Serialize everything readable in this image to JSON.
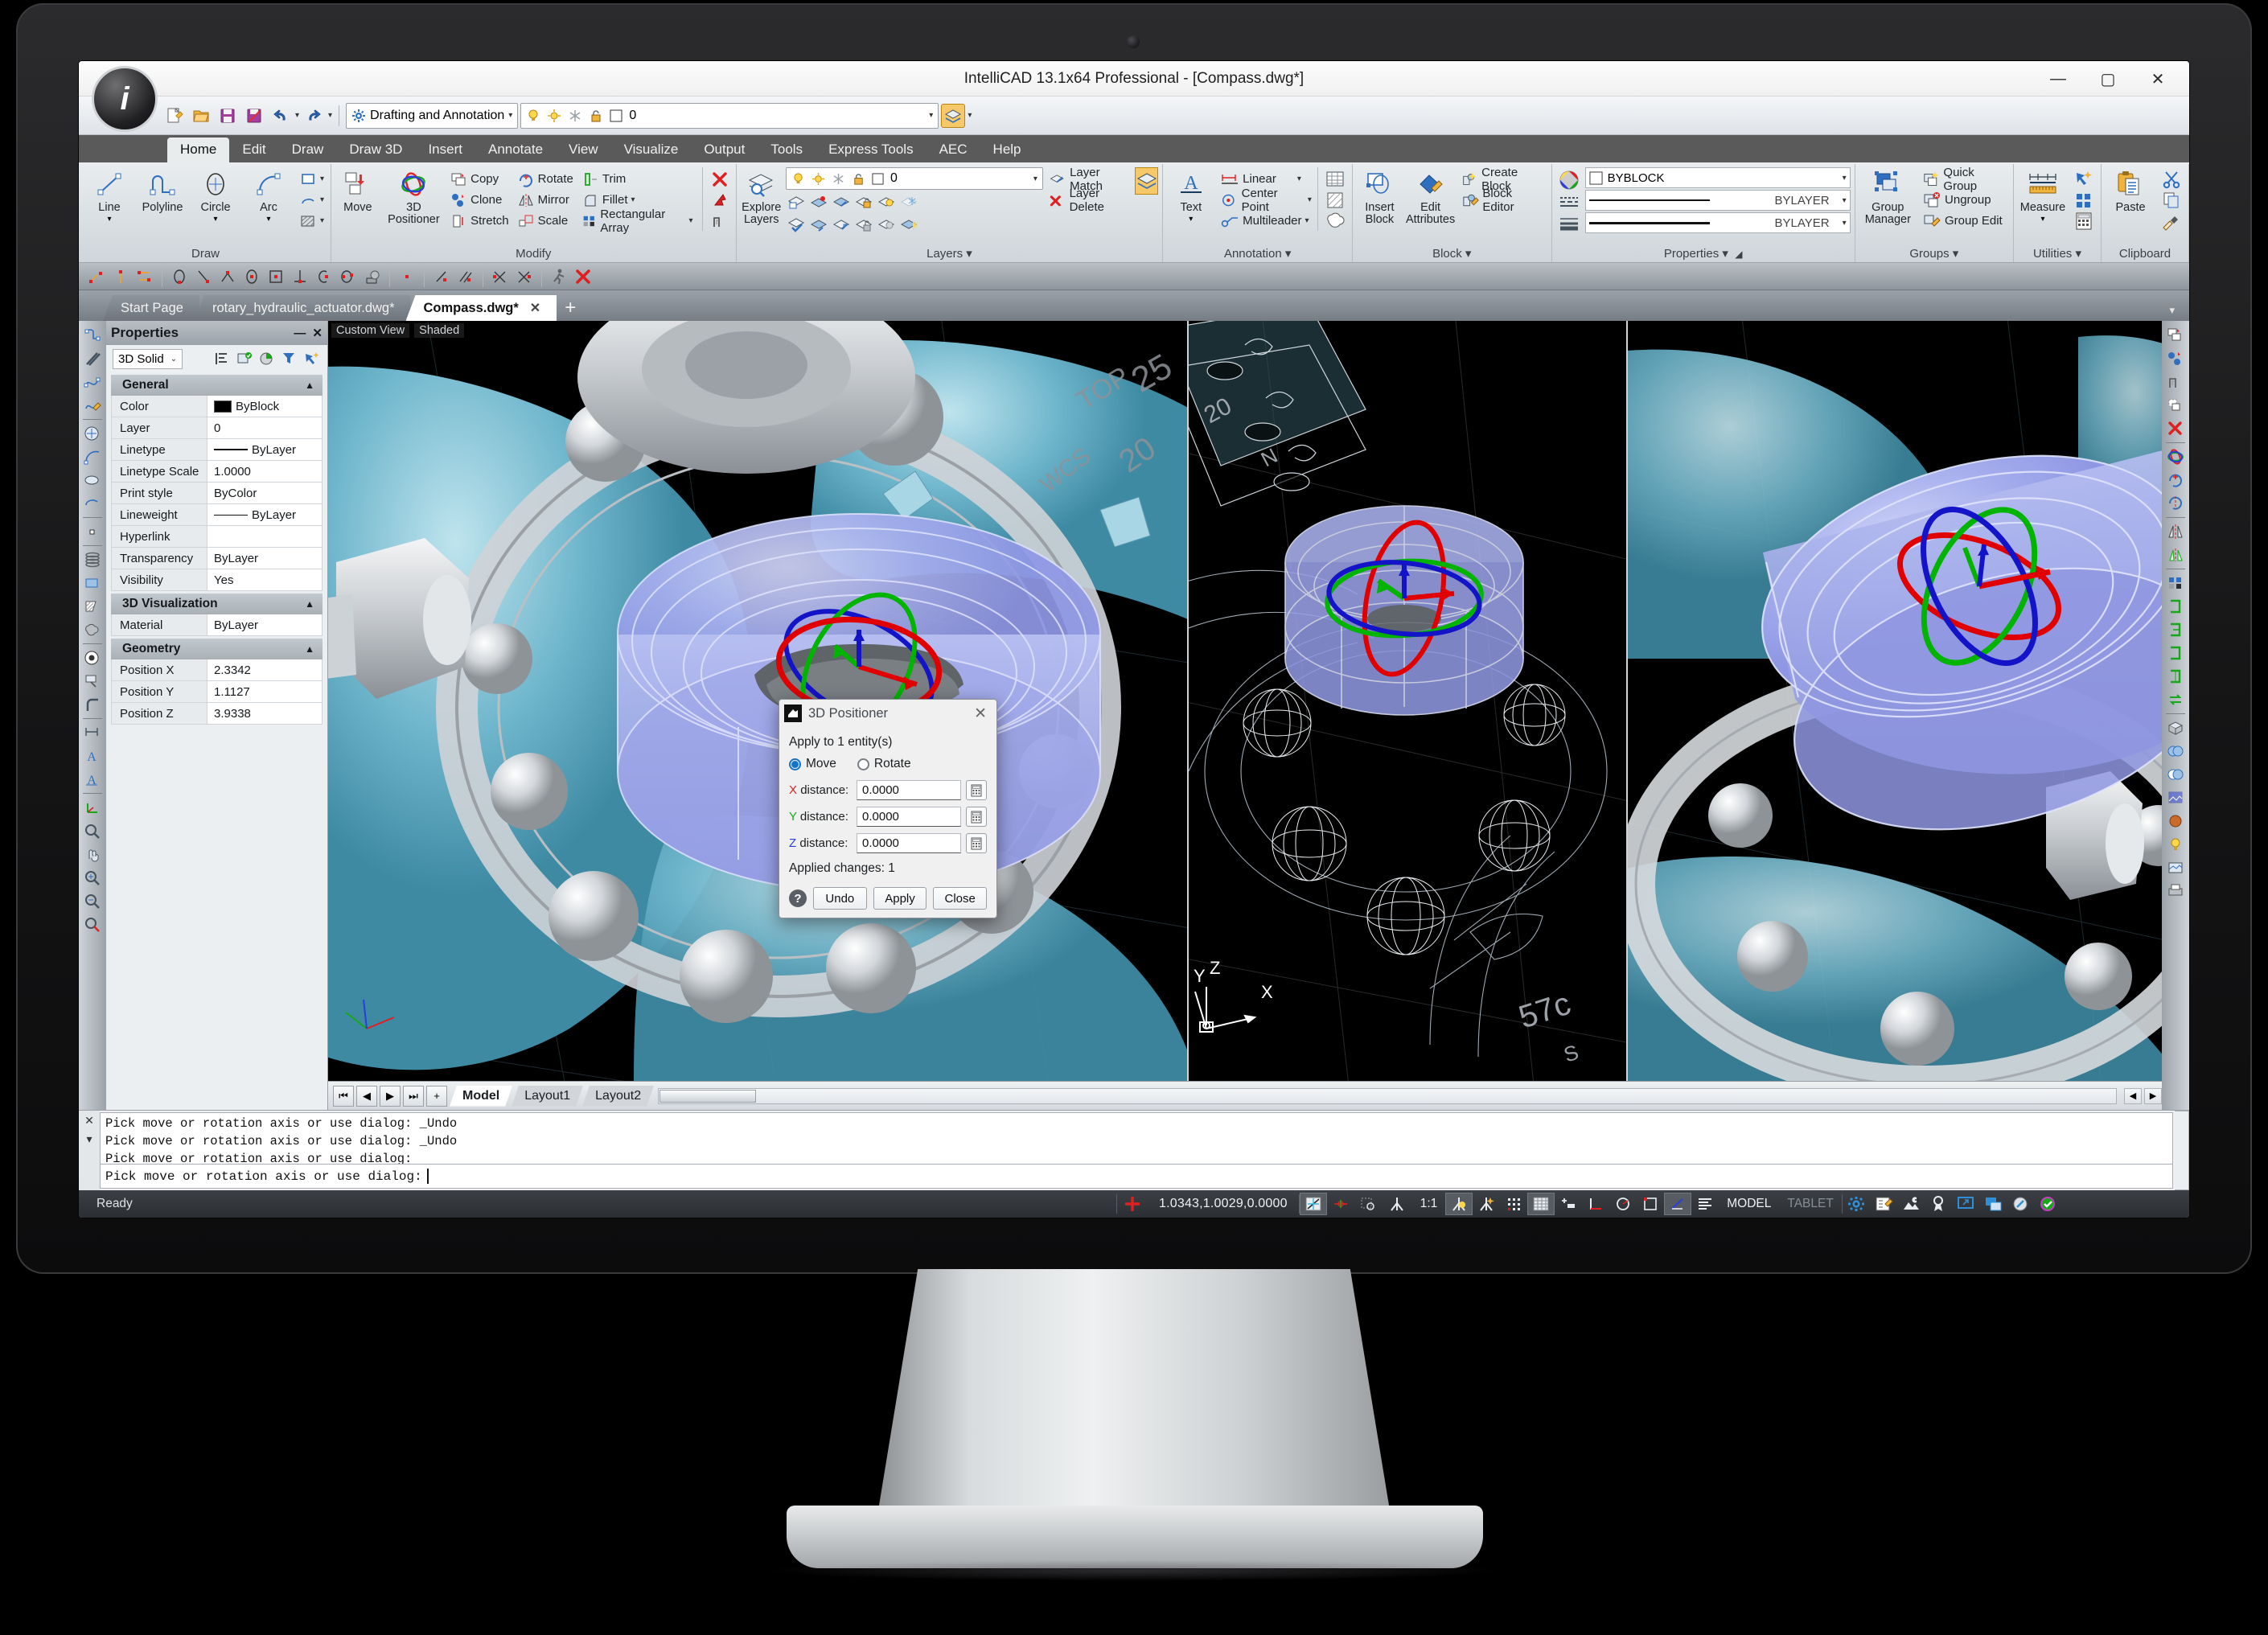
{
  "window": {
    "title": "IntelliCAD 13.1x64 Professional  - [Compass.dwg*]",
    "minimize": "—",
    "maximize": "▢",
    "close": "✕"
  },
  "quick_access": {
    "workspace": "Drafting and Annotation",
    "layer_value": "0",
    "icons": [
      "new-icon",
      "open-icon",
      "save-icon",
      "save-as-icon",
      "undo-icon",
      "redo-icon"
    ],
    "overflow": "▾"
  },
  "ribbon": {
    "tabs": [
      "Home",
      "Edit",
      "Draw",
      "Draw 3D",
      "Insert",
      "Annotate",
      "View",
      "Visualize",
      "Output",
      "Tools",
      "Express Tools",
      "AEC",
      "Help"
    ],
    "active_tab": "Home",
    "groups": [
      {
        "label": "Draw",
        "big": [
          {
            "label": "Line",
            "icon": "line-icon"
          },
          {
            "label": "Polyline",
            "icon": "polyline-icon"
          },
          {
            "label": "Circle",
            "icon": "circle-icon"
          },
          {
            "label": "Arc",
            "icon": "arc-icon"
          }
        ],
        "small": [
          "rectangle-icon",
          "ellipse-arc-icon",
          "hatch-icon"
        ]
      },
      {
        "label": "Modify",
        "big": [
          {
            "label": "Move",
            "icon": "move-icon"
          },
          {
            "label": "3D Positioner",
            "icon": "3d-positioner-icon"
          }
        ],
        "cols": [
          [
            "Copy",
            "Clone",
            "Stretch"
          ],
          [
            "Rotate",
            "Mirror",
            "Scale"
          ],
          [
            "Trim",
            "Fillet",
            "Rectangular Array"
          ]
        ],
        "extra": [
          "erase-icon",
          "explode-icon",
          "offset-icon"
        ]
      },
      {
        "label": "Layers",
        "big": [
          {
            "label": "Explore Layers",
            "icon": "explore-layers-icon"
          }
        ],
        "layer_value": "0",
        "actions": [
          "Layer Match",
          "Layer Delete"
        ]
      },
      {
        "label": "Annotation",
        "big": [
          {
            "label": "Text",
            "icon": "text-icon"
          }
        ],
        "items": [
          "Linear",
          "Center Point",
          "Multileader"
        ],
        "side": [
          "table-icon",
          "revision-cloud-icon",
          "wipeout-icon"
        ]
      },
      {
        "label": "Block",
        "big": [
          {
            "label": "Insert Block",
            "icon": "insert-block-icon"
          },
          {
            "label": "Edit Attributes",
            "icon": "edit-attributes-icon"
          }
        ],
        "items": [
          "Create Block",
          "Block Editor"
        ]
      },
      {
        "label": "Properties",
        "rows": [
          {
            "label": "BYBLOCK",
            "kind": "color"
          },
          {
            "label": "BYLAYER",
            "kind": "linetype"
          },
          {
            "label": "BYLAYER",
            "kind": "lineweight"
          }
        ]
      },
      {
        "label": "Groups",
        "big": [
          {
            "label": "Group Manager",
            "icon": "group-manager-icon"
          }
        ],
        "items": [
          "Quick Group",
          "Ungroup",
          "Group Edit"
        ]
      },
      {
        "label": "Utilities",
        "big": [
          {
            "label": "Measure",
            "icon": "measure-icon"
          }
        ],
        "side": [
          "quick-select-icon",
          "apps-icon",
          "calculator-icon"
        ]
      },
      {
        "label": "Clipboard",
        "big": [
          {
            "label": "Paste",
            "icon": "paste-icon"
          }
        ],
        "side": [
          "cut-icon",
          "copy-icon",
          "match-properties-icon"
        ]
      }
    ]
  },
  "doc_tabs": {
    "items": [
      {
        "label": "Start Page",
        "active": false,
        "closable": false
      },
      {
        "label": "rotary_hydraulic_actuator.dwg*",
        "active": false,
        "closable": false
      },
      {
        "label": "Compass.dwg*",
        "active": true,
        "closable": true
      }
    ],
    "close_glyph": "✕",
    "new_tab": "+"
  },
  "properties_panel": {
    "title": "Properties",
    "minimize": "—",
    "close": "✕",
    "entity_type": "3D Solid",
    "tool_icons": [
      "quick-select-icon",
      "select-similar-icon",
      "pick-add-icon",
      "filter-icon",
      "match-properties-icon"
    ],
    "sections": [
      {
        "name": "General",
        "collapse": "▲",
        "rows": [
          {
            "key": "Color",
            "value": "ByBlock",
            "kind": "color"
          },
          {
            "key": "Layer",
            "value": "0"
          },
          {
            "key": "Linetype",
            "value": "ByLayer",
            "kind": "line"
          },
          {
            "key": "Linetype Scale",
            "value": "1.0000"
          },
          {
            "key": "Print style",
            "value": "ByColor"
          },
          {
            "key": "Lineweight",
            "value": "ByLayer",
            "kind": "line"
          },
          {
            "key": "Hyperlink",
            "value": ""
          },
          {
            "key": "Transparency",
            "value": "ByLayer"
          },
          {
            "key": "Visibility",
            "value": "Yes"
          }
        ]
      },
      {
        "name": "3D Visualization",
        "collapse": "▲",
        "rows": [
          {
            "key": "Material",
            "value": "ByLayer"
          }
        ]
      },
      {
        "name": "Geometry",
        "collapse": "▲",
        "rows": [
          {
            "key": "Position X",
            "value": "2.3342"
          },
          {
            "key": "Position Y",
            "value": "1.1127"
          },
          {
            "key": "Position Z",
            "value": "3.9338"
          }
        ]
      }
    ]
  },
  "viewports": [
    {
      "name": "left-viewport",
      "labels": [
        "Custom View",
        "Shaded"
      ],
      "style": "shaded"
    },
    {
      "name": "middle-viewport",
      "labels": [],
      "style": "wireframe",
      "ucs": {
        "x": "X",
        "y": "Y",
        "z": "Z"
      }
    },
    {
      "name": "right-viewport",
      "labels": [],
      "style": "shaded"
    }
  ],
  "dialog": {
    "title": "3D Positioner",
    "close": "✕",
    "apply_to": "Apply to 1 entity(s)",
    "modes": [
      {
        "label": "Move",
        "selected": true
      },
      {
        "label": "Rotate",
        "selected": false
      }
    ],
    "fields": [
      {
        "axis": "X",
        "label": "distance:",
        "value": "0.0000",
        "color": "#e02020"
      },
      {
        "axis": "Y",
        "label": "distance:",
        "value": "0.0000",
        "color": "#17a81a"
      },
      {
        "axis": "Z",
        "label": "distance:",
        "value": "0.0000",
        "color": "#2b3ddd"
      }
    ],
    "calc_icon": "calculator-icon",
    "applied_changes": "Applied changes: 1",
    "help": "?",
    "buttons": [
      "Undo",
      "Apply",
      "Close"
    ]
  },
  "model_tabs": {
    "nav": [
      "⏮",
      "◀",
      "▶",
      "⏭",
      "+"
    ],
    "tabs": [
      {
        "label": "Model",
        "active": true
      },
      {
        "label": "Layout1",
        "active": false
      },
      {
        "label": "Layout2",
        "active": false
      }
    ]
  },
  "command_line": {
    "history": [
      "Pick move or rotation axis or use dialog: _Undo",
      "Pick move or rotation axis or use dialog: _Undo",
      "Pick move or rotation axis or use dialog:"
    ],
    "prompt": "Pick move or rotation axis or use dialog:",
    "close_glyph": "✕",
    "expand_glyph": "▾"
  },
  "status_bar": {
    "ready": "Ready",
    "coordinates": "1.0343,1.0029,0.0000",
    "scale": "1:1",
    "space": "MODEL",
    "tablet": "TABLET",
    "toggles": [
      "snap-icon",
      "grid-snap-icon",
      "selection-cycling-icon",
      "osnap-icon",
      "otrack-icon",
      "dynamic-ucs-icon",
      "polar-icon",
      "grid-icon",
      "dynamic-input-icon",
      "ortho-icon",
      "polar-tracking-icon",
      "isometric-icon",
      "lineweight-icon",
      "angle-icon",
      "quick-properties-icon"
    ],
    "right_icons": [
      "settings-gear-icon",
      "annotation-scale-icon",
      "viewport-config-icon",
      "badge-icon",
      "fullscreen-icon",
      "window-layout-icon",
      "clean-screen-icon",
      "check-status-icon"
    ]
  }
}
